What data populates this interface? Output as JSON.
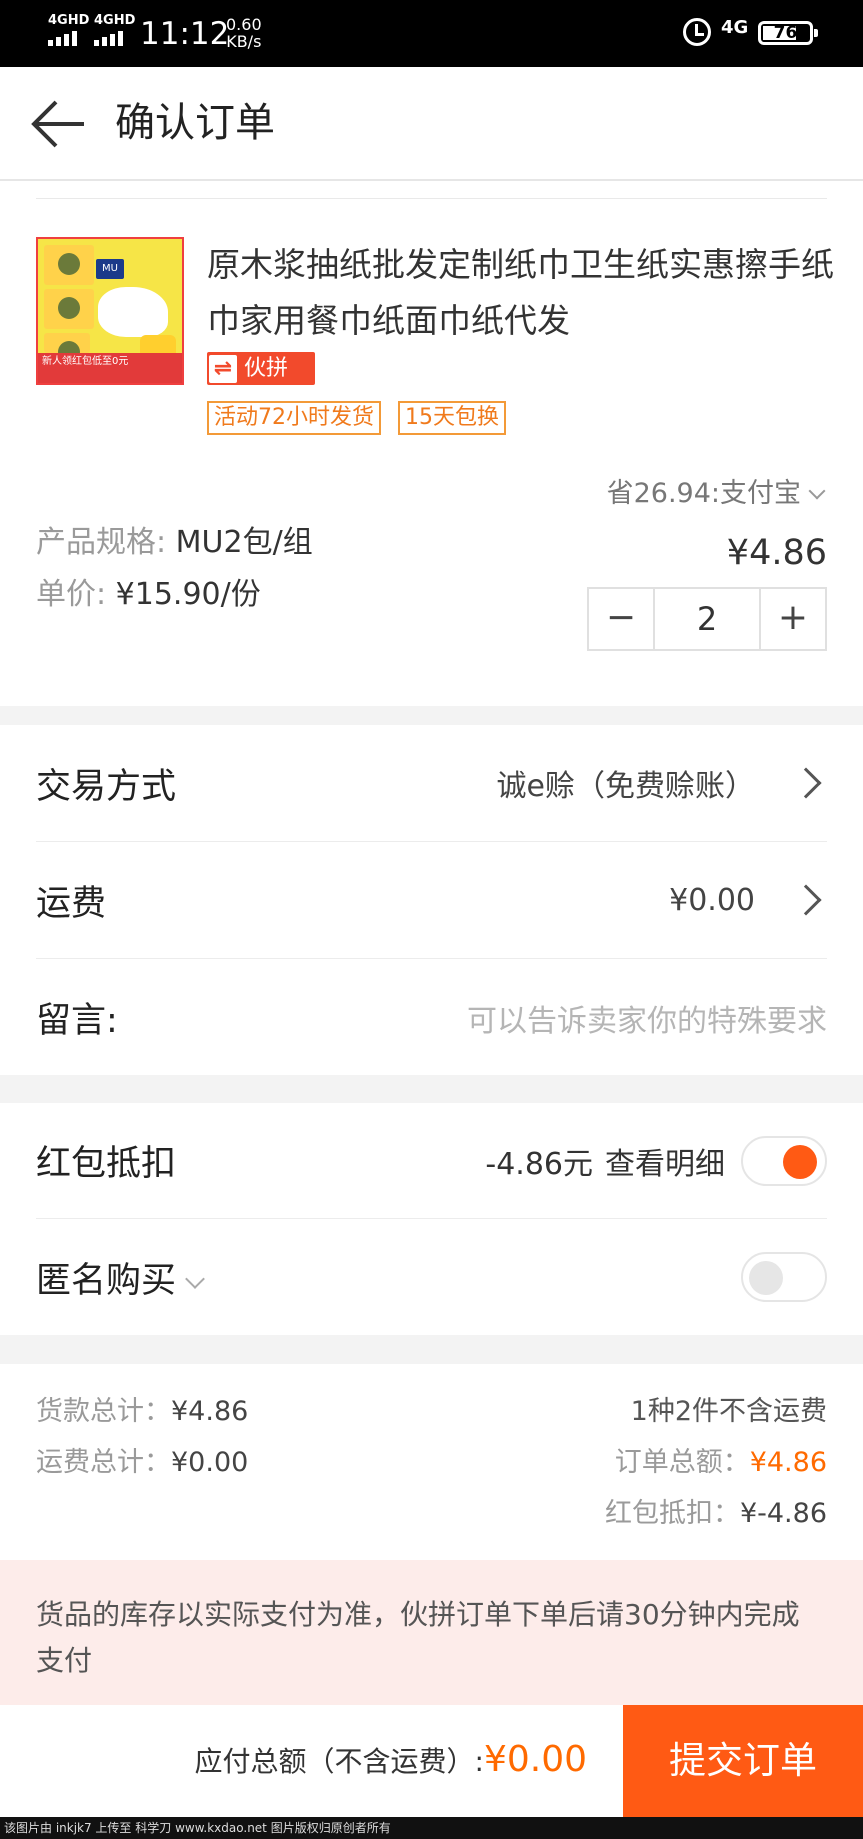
{
  "status_bar": {
    "net1": "4GHD",
    "net2": "4GHD",
    "time": "11:12",
    "speed_value": "0.60",
    "speed_unit": "KB/s",
    "net3": "4G",
    "battery": "76",
    "battery_level": 0.76
  },
  "header": {
    "title": "确认订单",
    "back_icon": "arrow-left-icon"
  },
  "product": {
    "title": "原木浆抽纸批发定制纸巾卫生纸实惠擦手纸巾家用餐巾纸面巾纸代发",
    "badge_text": "伙拼",
    "tags": [
      "活动72小时发货",
      "15天包换"
    ],
    "saving_text": "省26.94:支付宝",
    "spec_label": "产品规格:",
    "spec_value": "MU2包/组",
    "unit_label": "单价:",
    "unit_value": "¥15.90/份",
    "price": "¥4.86",
    "quantity": "2",
    "minus": "−",
    "plus": "+",
    "image_texts": {
      "brand": "MU",
      "banner": "新人领红包低至0元"
    }
  },
  "rows": {
    "trade_label": "交易方式",
    "trade_value": "诚e赊（免费赊账）",
    "shipping_label": "运费",
    "shipping_value": "¥0.00",
    "message_label": "留言:",
    "message_placeholder": "可以告诉卖家你的特殊要求"
  },
  "options": {
    "redpacket_label": "红包抵扣",
    "redpacket_value": "-4.86元",
    "redpacket_detail": "查看明细",
    "redpacket_on": true,
    "anonymous_label": "匿名购买",
    "anonymous_on": false
  },
  "summary": {
    "goods_total_label": "货款总计：",
    "goods_total_value": "¥4.86",
    "shipping_total_label": "运费总计：",
    "shipping_total_value": "¥0.00",
    "items_text": "1种2件不含运费",
    "order_total_label": "订单总额：",
    "order_total_value": "¥4.86",
    "redpacket_label": "红包抵扣：",
    "redpacket_value": "¥-4.86"
  },
  "notice": "货品的库存以实际支付为准，伙拼订单下单后请30分钟内完成支付",
  "footer": {
    "payable_label": "应付总额（不含运费）:",
    "payable_value": "¥0.00",
    "submit": "提交订单"
  },
  "watermark": "该图片由 inkjk7 上传至 科学刀 www.kxdao.net 图片版权归原创者所有",
  "colors": {
    "accent": "#ff5a14",
    "price_orange": "#ff6a00",
    "badge_red": "#f24a2c",
    "tag_orange": "#f39a38",
    "notice_bg": "#fdecea"
  }
}
